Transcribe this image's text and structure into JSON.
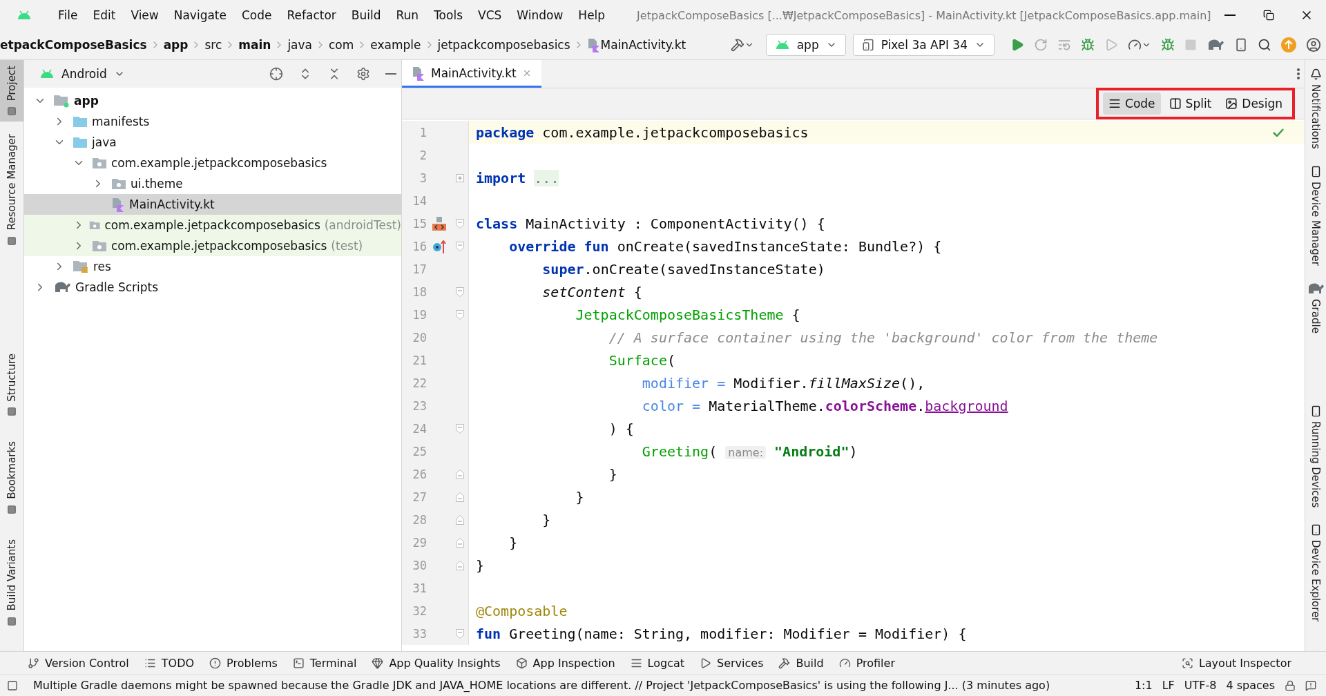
{
  "window": {
    "title": "JetpackComposeBasics [...₩JetpackComposeBasics] - MainActivity.kt [JetpackComposeBasics.app.main]"
  },
  "menu": [
    "File",
    "Edit",
    "View",
    "Navigate",
    "Code",
    "Refactor",
    "Build",
    "Run",
    "Tools",
    "VCS",
    "Window",
    "Help"
  ],
  "breadcrumbs": [
    {
      "label": "etpackComposeBasics",
      "bold": true
    },
    {
      "label": "app",
      "bold": true
    },
    {
      "label": "src",
      "bold": false
    },
    {
      "label": "main",
      "bold": true
    },
    {
      "label": "java",
      "bold": false
    },
    {
      "label": "com",
      "bold": false
    },
    {
      "label": "example",
      "bold": false
    },
    {
      "label": "jetpackcomposebasics",
      "bold": false
    },
    {
      "label": "MainActivity.kt",
      "bold": false,
      "kind": "kotlin"
    }
  ],
  "toolbar": {
    "run_config": "app",
    "device": "Pixel 3a API 34"
  },
  "left_strip": [
    {
      "label": "Project",
      "selected": true
    },
    {
      "label": "Resource Manager",
      "selected": false
    },
    {
      "label": "Structure",
      "selected": false
    },
    {
      "label": "Bookmarks",
      "selected": false
    },
    {
      "label": "Build Variants",
      "selected": false
    }
  ],
  "project_panel": {
    "view": "Android",
    "tree": [
      {
        "label": "app",
        "kind": "module",
        "bold": true,
        "expanded": true,
        "selected": false,
        "test_source": false,
        "children": [
          {
            "label": "manifests",
            "kind": "folder",
            "bold": false,
            "expanded": false,
            "selected": false,
            "test_source": false
          },
          {
            "label": "java",
            "kind": "folder",
            "bold": false,
            "expanded": true,
            "selected": false,
            "test_source": false,
            "children": [
              {
                "label": "com.example.jetpackcomposebasics",
                "kind": "package",
                "bold": false,
                "expanded": true,
                "selected": false,
                "test_source": false,
                "children": [
                  {
                    "label": "ui.theme",
                    "kind": "package",
                    "bold": false,
                    "expanded": false,
                    "selected": false,
                    "test_source": false
                  },
                  {
                    "label": "MainActivity.kt",
                    "kind": "kotlin",
                    "bold": false,
                    "selected": true,
                    "test_source": false
                  }
                ]
              },
              {
                "label": "com.example.jetpackcomposebasics",
                "suffix": "(androidTest)",
                "kind": "package",
                "bold": false,
                "expanded": false,
                "selected": false,
                "test_source": true
              },
              {
                "label": "com.example.jetpackcomposebasics",
                "suffix": "(test)",
                "kind": "package",
                "bold": false,
                "expanded": false,
                "selected": false,
                "test_source": true
              }
            ]
          },
          {
            "label": "res",
            "kind": "res",
            "bold": false,
            "expanded": false,
            "selected": false,
            "test_source": false
          }
        ]
      },
      {
        "label": "Gradle Scripts",
        "kind": "gradle",
        "bold": false,
        "expanded": false,
        "selected": false,
        "test_source": false
      }
    ]
  },
  "editor": {
    "tab": {
      "label": "MainActivity.kt",
      "selected": true
    },
    "modes": [
      {
        "label": "Code",
        "kind": "code",
        "selected": true
      },
      {
        "label": "Split",
        "kind": "split",
        "selected": false
      },
      {
        "label": "Design",
        "kind": "design",
        "selected": false
      }
    ],
    "lines": [
      {
        "number": "1",
        "current": true,
        "tokens": [
          {
            "kind": "kw",
            "text": "package "
          },
          {
            "kind": "plain",
            "text": "com.example.jetpackcomposebasics"
          }
        ]
      },
      {
        "number": "2",
        "current": false
      },
      {
        "number": "3",
        "current": false,
        "fold": {
          "kind": "collapsed"
        },
        "tokens": [
          {
            "kind": "kw",
            "text": "import "
          },
          {
            "kind": "folded",
            "text": "..."
          }
        ]
      },
      {
        "number": "14",
        "current": false
      },
      {
        "number": "15",
        "current": false,
        "fold": {
          "kind": "open"
        },
        "marker": {
          "kind": "preview"
        },
        "tokens": [
          {
            "kind": "kw",
            "text": "class "
          },
          {
            "kind": "plain",
            "text": "MainActivity : ComponentActivity() {"
          }
        ]
      },
      {
        "number": "16",
        "current": false,
        "fold": {
          "kind": "open"
        },
        "marker": {
          "kind": "override"
        },
        "tokens": [
          {
            "kind": "kw",
            "text": "    override fun "
          },
          {
            "kind": "plain",
            "text": "onCreate(savedInstanceState: Bundle?) {"
          }
        ]
      },
      {
        "number": "17",
        "current": false,
        "tokens": [
          {
            "kind": "kw",
            "text": "        super"
          },
          {
            "kind": "plain",
            "text": ".onCreate(savedInstanceState)"
          }
        ]
      },
      {
        "number": "18",
        "current": false,
        "fold": {
          "kind": "open"
        },
        "tokens": [
          {
            "kind": "ital",
            "text": "        setContent "
          },
          {
            "kind": "plain",
            "text": "{"
          }
        ]
      },
      {
        "number": "19",
        "current": false,
        "fold": {
          "kind": "open"
        },
        "tokens": [
          {
            "kind": "call",
            "text": "            JetpackComposeBasicsTheme "
          },
          {
            "kind": "plain",
            "text": "{"
          }
        ]
      },
      {
        "number": "20",
        "current": false,
        "tokens": [
          {
            "kind": "comment",
            "text": "                // A surface container using the 'background' color from the theme"
          }
        ]
      },
      {
        "number": "21",
        "current": false,
        "tokens": [
          {
            "kind": "call",
            "text": "                Surface"
          },
          {
            "kind": "plain",
            "text": "("
          }
        ]
      },
      {
        "number": "22",
        "current": false,
        "tokens": [
          {
            "kind": "param",
            "text": "                    modifier = "
          },
          {
            "kind": "plain",
            "text": "Modifier."
          },
          {
            "kind": "ital",
            "text": "fillMaxSize"
          },
          {
            "kind": "plain",
            "text": "(),"
          }
        ]
      },
      {
        "number": "23",
        "current": false,
        "tokens": [
          {
            "kind": "param",
            "text": "                    color = "
          },
          {
            "kind": "plain",
            "text": "MaterialTheme."
          },
          {
            "kind": "field",
            "text": "colorScheme"
          },
          {
            "kind": "plain",
            "text": "."
          },
          {
            "kind": "link",
            "text": "background"
          }
        ]
      },
      {
        "number": "24",
        "current": false,
        "fold": {
          "kind": "open"
        },
        "tokens": [
          {
            "kind": "plain",
            "text": "                ) {"
          }
        ]
      },
      {
        "number": "25",
        "current": false,
        "tokens": [
          {
            "kind": "call",
            "text": "                    Greeting"
          },
          {
            "kind": "plain",
            "text": "( "
          },
          {
            "kind": "hint",
            "text": "name:"
          },
          {
            "kind": "str",
            "text": " \"Android\""
          },
          {
            "kind": "plain",
            "text": ")"
          }
        ]
      },
      {
        "number": "26",
        "current": false,
        "fold": {
          "kind": "end"
        },
        "tokens": [
          {
            "kind": "plain",
            "text": "                }"
          }
        ]
      },
      {
        "number": "27",
        "current": false,
        "fold": {
          "kind": "end"
        },
        "tokens": [
          {
            "kind": "plain",
            "text": "            }"
          }
        ]
      },
      {
        "number": "28",
        "current": false,
        "fold": {
          "kind": "end"
        },
        "tokens": [
          {
            "kind": "plain",
            "text": "        }"
          }
        ]
      },
      {
        "number": "29",
        "current": false,
        "fold": {
          "kind": "end"
        },
        "tokens": [
          {
            "kind": "plain",
            "text": "    }"
          }
        ]
      },
      {
        "number": "30",
        "current": false,
        "fold": {
          "kind": "end"
        },
        "tokens": [
          {
            "kind": "plain",
            "text": "}"
          }
        ]
      },
      {
        "number": "31",
        "current": false
      },
      {
        "number": "32",
        "current": false,
        "tokens": [
          {
            "kind": "anno",
            "text": "@Composable"
          }
        ]
      },
      {
        "number": "33",
        "current": false,
        "fold": {
          "kind": "open"
        },
        "tokens": [
          {
            "kind": "kw",
            "text": "fun "
          },
          {
            "kind": "plain",
            "text": "Greeting(name: String, modifier: Modifier = Modifier) {"
          }
        ]
      }
    ]
  },
  "right_strip": [
    {
      "label": "Notifications",
      "kind": "bell"
    },
    {
      "label": "Device Manager",
      "kind": "device"
    },
    {
      "label": "Gradle",
      "kind": "gradle"
    },
    {
      "label": "Running Devices",
      "kind": "device"
    },
    {
      "label": "Device Explorer",
      "kind": "device"
    }
  ],
  "bottom_tools": [
    {
      "label": "Version Control",
      "kind": "vcs"
    },
    {
      "label": "TODO",
      "kind": "list"
    },
    {
      "label": "Problems",
      "kind": "problems"
    },
    {
      "label": "Terminal",
      "kind": "terminal"
    },
    {
      "label": "App Quality Insights",
      "kind": "gem"
    },
    {
      "label": "App Inspection",
      "kind": "inspect"
    },
    {
      "label": "Logcat",
      "kind": "logcat"
    },
    {
      "label": "Services",
      "kind": "services"
    },
    {
      "label": "Build",
      "kind": "build"
    },
    {
      "label": "Profiler",
      "kind": "profiler"
    }
  ],
  "bottom_tools_right": {
    "label": "Layout Inspector"
  },
  "status_bar": {
    "message": "Multiple Gradle daemons might be spawned because the Gradle JDK and JAVA_HOME locations are different. // Project 'JetpackComposeBasics' is using the following J... (3 minutes ago)",
    "items": [
      "1:1",
      "LF",
      "UTF-8",
      "4 spaces"
    ]
  }
}
